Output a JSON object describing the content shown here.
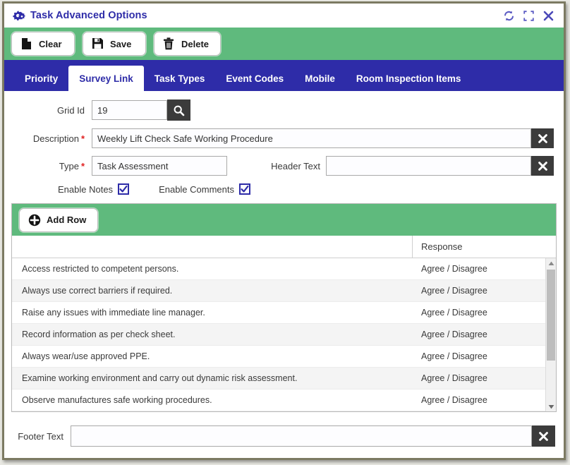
{
  "window": {
    "title": "Task Advanced Options",
    "icon": "gears-icon",
    "controls": [
      {
        "name": "refresh-icon",
        "label": "Refresh"
      },
      {
        "name": "maximize-icon",
        "label": "Maximize"
      },
      {
        "name": "close-icon",
        "label": "Close"
      }
    ]
  },
  "toolbar": {
    "clear_label": "Clear",
    "save_label": "Save",
    "delete_label": "Delete"
  },
  "tabs": [
    {
      "label": "Priority",
      "active": false
    },
    {
      "label": "Survey Link",
      "active": true
    },
    {
      "label": "Task Types",
      "active": false
    },
    {
      "label": "Event Codes",
      "active": false
    },
    {
      "label": "Mobile",
      "active": false
    },
    {
      "label": "Room Inspection Items",
      "active": false
    }
  ],
  "form": {
    "grid_id": {
      "label": "Grid Id",
      "value": "19",
      "search_icon": "search-icon"
    },
    "description": {
      "label": "Description",
      "required": "*",
      "value": "Weekly Lift Check Safe Working Procedure",
      "clear_icon": "clear-x-icon"
    },
    "type": {
      "label": "Type",
      "required": "*",
      "value": "Task Assessment"
    },
    "header_text": {
      "label": "Header Text",
      "value": "",
      "placeholder": "",
      "clear_icon": "clear-x-icon"
    },
    "enable_notes": {
      "label": "Enable Notes",
      "checked": true
    },
    "enable_comments": {
      "label": "Enable Comments",
      "checked": true
    }
  },
  "grid": {
    "add_row_label": "Add Row",
    "columns": [
      "",
      "Response"
    ],
    "rows": [
      {
        "item": "Access restricted to competent persons.",
        "response": "Agree / Disagree"
      },
      {
        "item": "Always use correct barriers if required.",
        "response": "Agree / Disagree"
      },
      {
        "item": "Raise any issues with immediate line manager.",
        "response": "Agree / Disagree"
      },
      {
        "item": "Record information as per check sheet.",
        "response": "Agree / Disagree"
      },
      {
        "item": "Always wear/use approved PPE.",
        "response": "Agree / Disagree"
      },
      {
        "item": "Examine working environment and carry out dynamic risk assessment.",
        "response": "Agree / Disagree"
      },
      {
        "item": "Observe manufactures safe working procedures.",
        "response": "Agree / Disagree"
      }
    ]
  },
  "footer": {
    "label": "Footer Text",
    "value": "",
    "placeholder": "",
    "clear_icon": "clear-x-icon"
  },
  "colors": {
    "toolbar_green": "#5fba7d",
    "tab_indigo": "#2e2ca8",
    "frame_olive": "#7c7a62",
    "dark_button": "#3b3b3b",
    "required_red": "#e02020"
  }
}
